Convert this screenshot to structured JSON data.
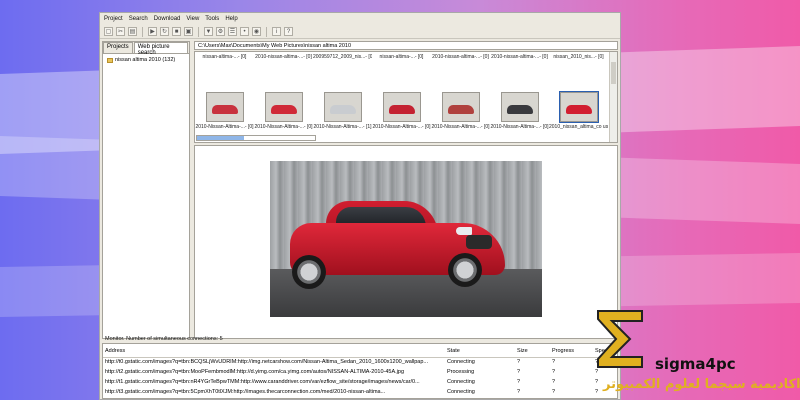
{
  "menu": [
    "Project",
    "Search",
    "Download",
    "View",
    "Tools",
    "Help"
  ],
  "toolbar_icons": [
    "new-icon",
    "cut-icon",
    "open-icon",
    "play-icon",
    "refresh-icon",
    "stop-icon",
    "save-icon",
    "filter-icon",
    "settings-icon",
    "list-icon",
    "options-icon",
    "connect-icon",
    "info-icon",
    "help-icon"
  ],
  "left_panel": {
    "tabs": [
      "Projects",
      "Web picture search"
    ],
    "tree_item": "nissan altima 2010 (132)"
  },
  "path": "C:\\Users\\Max\\Documents\\My Web Pictures\\nissan altima 2010",
  "thumbnails": {
    "row1": [
      "nissan-altima-...- [0]",
      "2010-nissan-altima-...- [0]",
      "200959712_2009_nis...- [0]",
      "nissan-altima-...- [0]",
      "2010-nissan-altima-...- [0]",
      "2010-nissan-altima-...- [0]",
      "nissan_2010_nis...- [0]"
    ],
    "row2": [
      "2010-Nissan-Altima-...- [0]",
      "2010-Nissan-Altima-...- [0]",
      "2010-Nissan-Altima-...- [1]",
      "2010-Nissan-Altima-...- [0]",
      "2010-Nissan-Altima-...- [0]",
      "2010-Nissan-Altima-...- [0]",
      "2010_nissan_altima_co use_images_main.jpg"
    ]
  },
  "monitor": {
    "title": "Monitor.  Number of simultaneous connections:  5",
    "columns": [
      "Address",
      "State",
      "Size",
      "Progress",
      "Speed"
    ],
    "rows": [
      {
        "address": "http://t0.gstatic.com/images?q=tbn:BCQSLjWvUDRIM:http://img.netcarshow.com/Nissan-Altima_Sedan_2010_1600x1200_wallpap...",
        "state": "Connecting",
        "size": "?",
        "progress": "?",
        "speed": "?"
      },
      {
        "address": "http://t2.gstatic.com/images?q=tbn:MooPFembmodlM:http://d.yimg.com/ca.yimg.com/autos/NISSAN-ALTIMA-2010-45A.jpg",
        "state": "Processing",
        "size": "?",
        "progress": "?",
        "speed": "?"
      },
      {
        "address": "http://t1.gstatic.com/images?q=tbn:nR4YGrTeBpwTMM:http://www.caranddriver.com/var/ezflow_site/storage/images/news/car/0...",
        "state": "Connecting",
        "size": "?",
        "progress": "?",
        "speed": "?"
      },
      {
        "address": "http://t3.gstatic.com/images?q=tbn:5CpmXhT0tlXJM:http://images.thecarconnection.com/med/2010-nissan-altima...",
        "state": "Connecting",
        "size": "?",
        "progress": "?",
        "speed": "?"
      }
    ]
  },
  "progress_fraction": 0.4,
  "watermark": {
    "name": "sigma4pc",
    "arabic": "اكاديمية سيجما لعلوم الكمبيوتر"
  },
  "colors": {
    "accent": "#2a5fb0",
    "car_red": "#d21e30",
    "logo_gold": "#e0b020"
  }
}
